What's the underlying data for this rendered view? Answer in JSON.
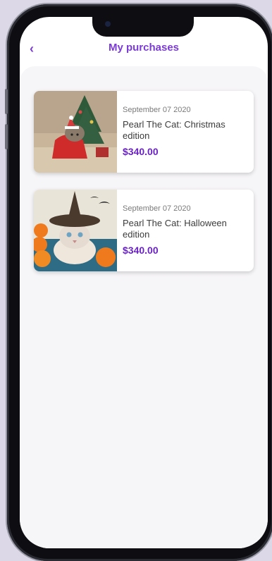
{
  "header": {
    "back_icon": "chevron-left-icon",
    "title": "My purchases"
  },
  "purchases": [
    {
      "date": "September 07 2020",
      "title": "Pearl The Cat: Christmas edition",
      "price": "$340.00"
    },
    {
      "date": "September 07 2020",
      "title": "Pearl The Cat: Halloween edition",
      "price": "$340.00"
    }
  ],
  "colors": {
    "accent": "#7b3bd6",
    "price": "#6a22c4",
    "background": "#dcd8e8"
  }
}
